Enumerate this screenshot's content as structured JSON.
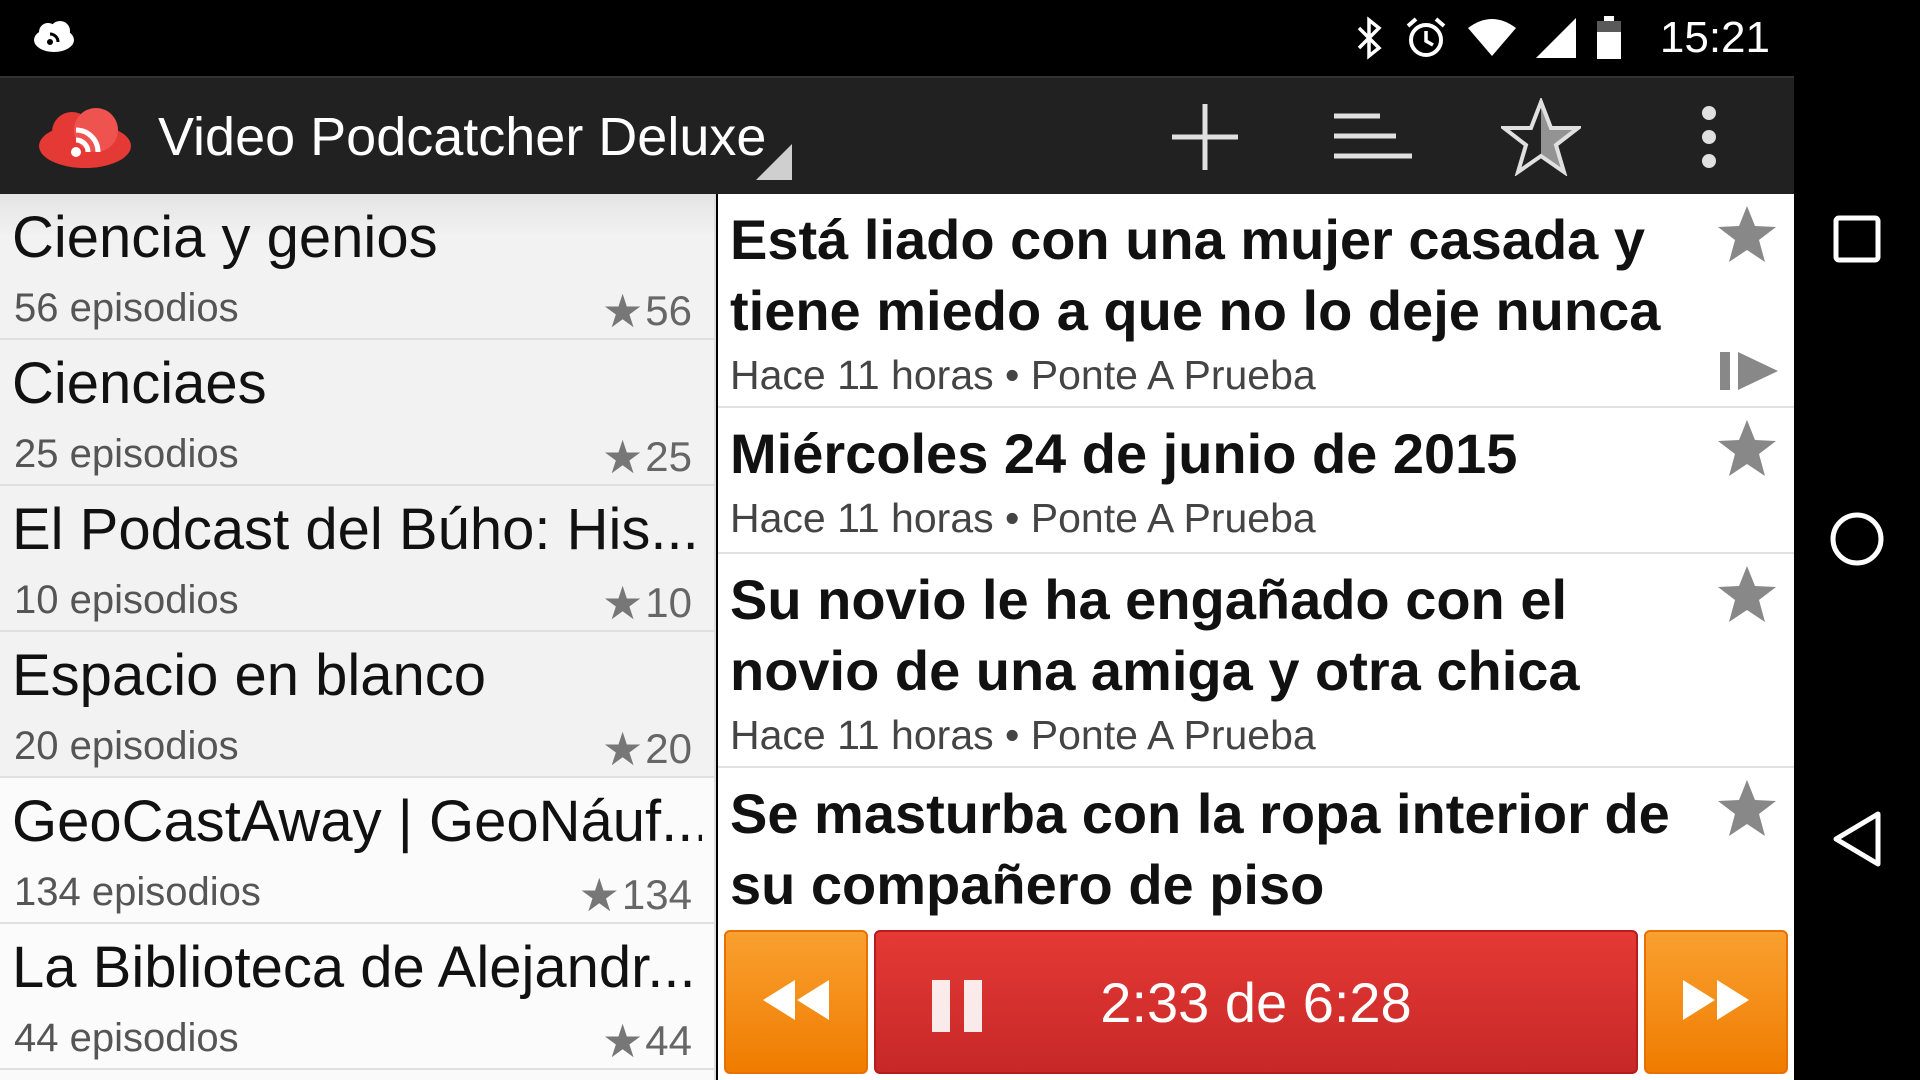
{
  "status_bar": {
    "time": "15:21",
    "icons": [
      "cloud-sync-icon",
      "bluetooth-icon",
      "alarm-icon",
      "wifi-icon",
      "signal-icon",
      "battery-icon"
    ]
  },
  "action_bar": {
    "title": "Video Podcatcher Deluxe",
    "actions": [
      "add-icon",
      "sort-icon",
      "star-outline-icon",
      "overflow-menu-icon"
    ]
  },
  "podcasts": [
    {
      "title": "Ciencia y genios",
      "count": "56 episodios",
      "stars": "56"
    },
    {
      "title": "Cienciaes",
      "count": "25 episodios",
      "stars": "25"
    },
    {
      "title": "El Podcast del Búho: His...",
      "count": "10 episodios",
      "stars": "10"
    },
    {
      "title": "Espacio en blanco",
      "count": "20 episodios",
      "stars": "20"
    },
    {
      "title": "GeoCastAway | GeoNáuf...",
      "count": "134 episodios",
      "stars": "134"
    },
    {
      "title": "La Biblioteca de Alejandr...",
      "count": "44 episodios",
      "stars": "44"
    }
  ],
  "episodes": [
    {
      "title": "Está liado con una mujer casada y tiene miedo a que no lo deje nunca",
      "meta": "Hace 11 horas • Ponte A Prueba",
      "playing": true
    },
    {
      "title": "Miércoles 24 de junio de 2015",
      "meta": "Hace 11 horas • Ponte A Prueba",
      "playing": false
    },
    {
      "title": "Su novio le ha engañado con el novio de una amiga y otra chica",
      "meta": "Hace 11 horas • Ponte A Prueba",
      "playing": false
    },
    {
      "title": "Se masturba con la ropa interior de su compañero de piso",
      "meta": "",
      "playing": false
    }
  ],
  "player": {
    "progress_text": "2:33 de 6:28",
    "colors": {
      "skip": "#f28c0f",
      "play": "#d32f2f"
    }
  },
  "nav_bar": [
    "recents-icon",
    "home-icon",
    "back-icon"
  ]
}
